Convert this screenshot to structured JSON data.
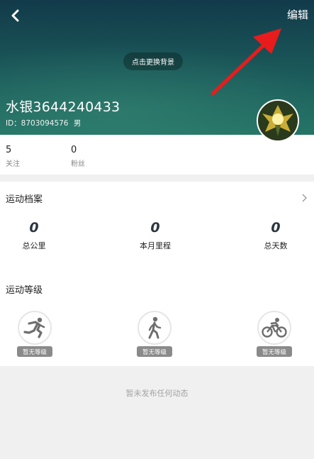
{
  "header": {
    "edit_label": "编辑",
    "change_bg_label": "点击更换背景",
    "username": "水银3644240433",
    "id_text": "ID：8703094576",
    "gender": "男"
  },
  "social": {
    "following_count": "5",
    "following_label": "关注",
    "followers_count": "0",
    "followers_label": "粉丝"
  },
  "sport_profile": {
    "title": "运动档案",
    "metrics": [
      {
        "value": "0",
        "label": "总公里"
      },
      {
        "value": "0",
        "label": "本月里程"
      },
      {
        "value": "0",
        "label": "总天数"
      }
    ]
  },
  "sport_level": {
    "title": "运动等级",
    "items": [
      {
        "icon": "running-icon",
        "badge": "暂无等级"
      },
      {
        "icon": "walking-icon",
        "badge": "暂无等级"
      },
      {
        "icon": "cycling-icon",
        "badge": "暂无等级"
      }
    ]
  },
  "feed": {
    "empty_text": "暂未发布任何动态"
  },
  "colors": {
    "annotation_arrow": "#e81c1c",
    "header_top": "#123a4a",
    "header_bottom": "#247466",
    "badge_gray": "#8a8a8a"
  }
}
